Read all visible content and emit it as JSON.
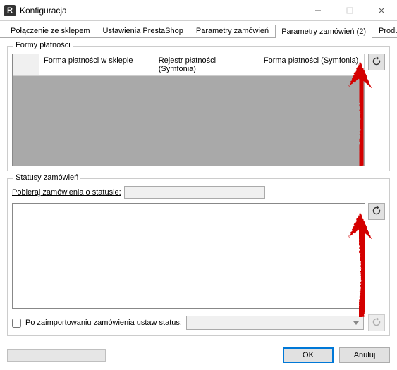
{
  "window": {
    "app_icon_letter": "R",
    "title": "Konfiguracja"
  },
  "tabs": {
    "items": [
      "Połączenie ze sklepem",
      "Ustawienia PrestaShop",
      "Parametry zamówień",
      "Parametry zamówień (2)",
      "Produkty"
    ],
    "active_index": 3
  },
  "payments_group": {
    "legend": "Formy płatności",
    "columns": [
      "Forma płatności w sklepie",
      "Rejestr płatności (Symfonia)",
      "Forma płatności (Symfonia)"
    ]
  },
  "statuses_group": {
    "legend": "Statusy zamówień",
    "fetch_label": "Pobieraj zamówienia o statusie:",
    "fetch_value": "",
    "post_import_label": "Po zaimportowaniu zamówienia ustaw status:",
    "post_import_checked": false,
    "post_import_combo_value": ""
  },
  "buttons": {
    "ok": "OK",
    "cancel": "Anuluj"
  }
}
